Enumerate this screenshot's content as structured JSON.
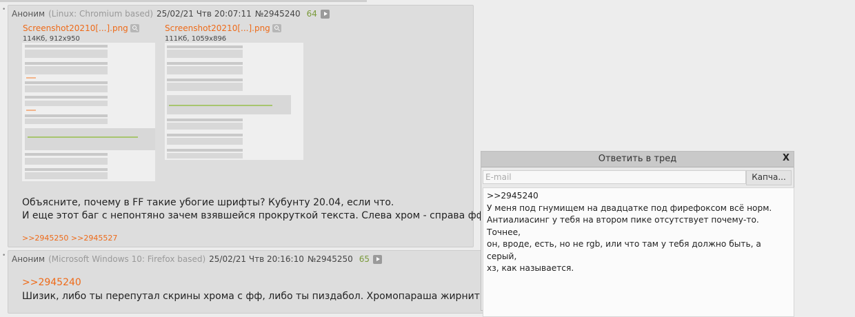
{
  "post1": {
    "name": "Аноним",
    "user_agent": "(Linux: Chromium based)",
    "datetime": "25/02/21 Чтв 20:07:11",
    "number": "№2945240",
    "count": "64",
    "files": [
      {
        "name": "Screenshot20210[...].png",
        "meta": "114Кб, 912x950"
      },
      {
        "name": "Screenshot20210[...].png",
        "meta": "111Кб, 1059x896"
      }
    ],
    "text_lines": [
      "Объясните, почему в FF такие убогие шрифты? Кубунту 20.04, если что.",
      "И еще этот баг с непонтяно зачем взявшейся прокруткой текста. Слева хром - справа фф."
    ],
    "replies": ">>2945250 >>2945527"
  },
  "post2": {
    "name": "Аноним",
    "user_agent": "(Microsoft Windows 10: Firefox based)",
    "datetime": "25/02/21 Чтв 20:16:10",
    "number": "№2945250",
    "count": "65",
    "quote": ">>2945240",
    "text": "Шизик, либо ты перепутал скрины хрома с фф, либо ты пиздабол. Хромопараша жирнит и мы"
  },
  "quick_reply": {
    "title": "Ответить в тред",
    "close": "X",
    "email_placeholder": "E-mail",
    "captcha_label": "Капча...",
    "message": ">>2945240\nУ меня под гнумищем на двадцатке под фирефоксом всё норм.\nАнтиалиасинг у тебя на втором пике отсутствует почему-то. Точнее,\nон, вроде, есть, но не rgb, или что там у тебя должно быть, а серый,\nхз, как называется."
  },
  "colors": {
    "accent": "#ee6a18",
    "count": "#7a9a3a",
    "post_bg": "#dddddd"
  }
}
